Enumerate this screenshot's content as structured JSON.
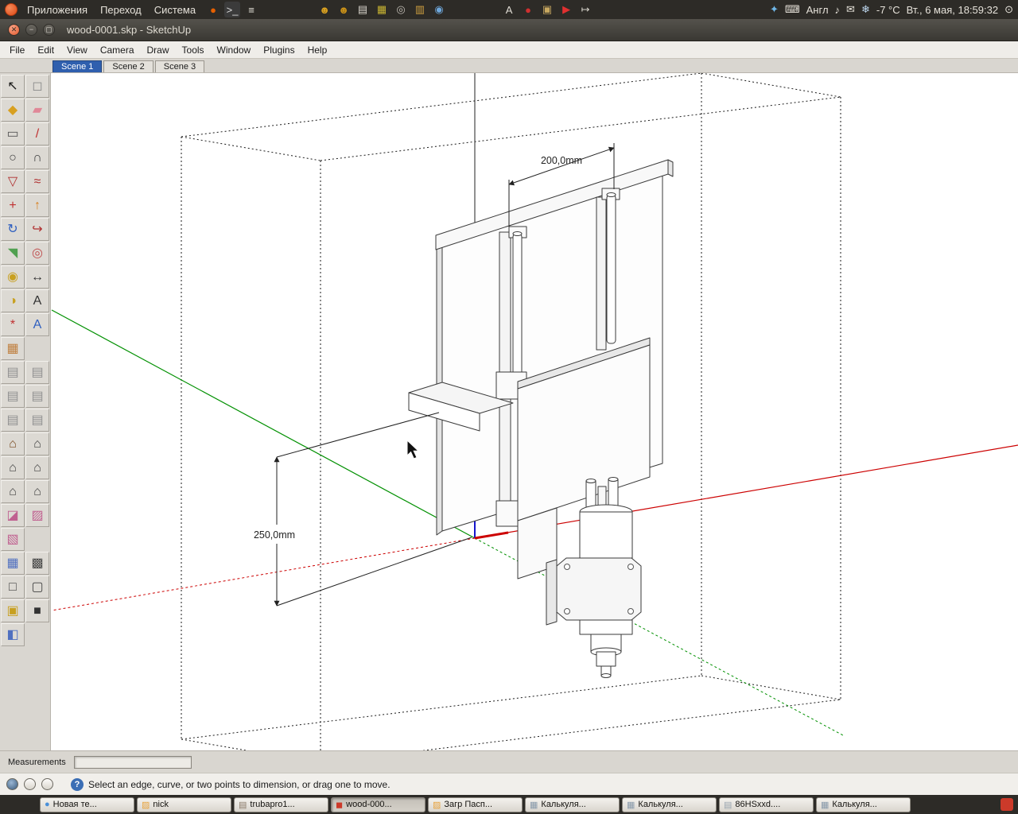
{
  "desktop": {
    "top_panel": {
      "menus": [
        "Приложения",
        "Переход",
        "Система"
      ],
      "launchers": [
        {
          "name": "firefox-icon",
          "glyph": "●",
          "color": "#E66000"
        },
        {
          "name": "terminal-icon",
          "glyph": ">_",
          "color": "#DDDDDD",
          "bg": "#3B3B3B"
        },
        {
          "name": "text-editor-icon",
          "glyph": "≡",
          "color": "#E8E4DC"
        },
        {
          "name": "spacer",
          "width": 64
        },
        {
          "name": "users-icon",
          "glyph": "☻",
          "color": "#D8A020"
        },
        {
          "name": "contacts-icon",
          "glyph": "☻",
          "color": "#C89018"
        },
        {
          "name": "notes-icon",
          "glyph": "▤",
          "color": "#D8D4CC"
        },
        {
          "name": "packages-icon",
          "glyph": "▦",
          "color": "#C8B432"
        },
        {
          "name": "disc-burner-icon",
          "glyph": "◎",
          "color": "#C0BCB4"
        },
        {
          "name": "archive-icon",
          "glyph": "▥",
          "color": "#D0A040"
        },
        {
          "name": "chromium-icon",
          "glyph": "◉",
          "color": "#6FA8DC"
        },
        {
          "name": "spacer",
          "width": 60
        },
        {
          "name": "fonts-icon",
          "glyph": "A",
          "color": "#E0DCD4"
        },
        {
          "name": "media-icon",
          "glyph": "●",
          "color": "#D03030"
        },
        {
          "name": "stamp-icon",
          "glyph": "▣",
          "color": "#C8A860"
        },
        {
          "name": "player-icon",
          "glyph": "▶",
          "color": "#E03030"
        },
        {
          "name": "share-icon",
          "glyph": "↦",
          "color": "#D8D4CC"
        }
      ],
      "keyboard_layout": "Англ",
      "weather": "-7 °C",
      "clock": "Вт., 6 мая, 18:59:32"
    },
    "icons": {
      "network": "✦",
      "keyboard": "⌨",
      "volume": "♪",
      "mail": "✉",
      "snowflake": "❄",
      "power": "⊙",
      "help": "?",
      "window_close": "✕",
      "window_min": "−",
      "window_max": "▢"
    }
  },
  "window": {
    "titlebar": {
      "title": "wood-0001.skp - SketchUp"
    },
    "menu_bar": [
      "File",
      "Edit",
      "View",
      "Camera",
      "Draw",
      "Tools",
      "Window",
      "Plugins",
      "Help"
    ],
    "scene_tabs": [
      {
        "label": "Scene 1",
        "active": true
      },
      {
        "label": "Scene 2",
        "active": false
      },
      {
        "label": "Scene 3",
        "active": false
      }
    ],
    "toolbar": [
      {
        "name": "select-tool",
        "glyph": "↖",
        "color": "#1A1A1A"
      },
      {
        "name": "make-component-tool",
        "glyph": "◻",
        "color": "#8A8A8A"
      },
      {
        "name": "paint-bucket-tool",
        "glyph": "◆",
        "color": "#D8A020"
      },
      {
        "name": "eraser-tool",
        "glyph": "▰",
        "color": "#E08898"
      },
      {
        "name": "rectangle-tool",
        "glyph": "▭",
        "color": "#555555"
      },
      {
        "name": "line-tool",
        "glyph": "/",
        "color": "#C03030"
      },
      {
        "name": "circle-tool",
        "glyph": "○",
        "color": "#444444"
      },
      {
        "name": "arc-tool",
        "glyph": "∩",
        "color": "#444444"
      },
      {
        "name": "polygon-tool",
        "glyph": "▽",
        "color": "#B03030"
      },
      {
        "name": "freehand-tool",
        "glyph": "≈",
        "color": "#B03030"
      },
      {
        "name": "move-tool",
        "glyph": "+",
        "color": "#C03030"
      },
      {
        "name": "push-pull-tool",
        "glyph": "↑",
        "color": "#D88020"
      },
      {
        "name": "rotate-tool",
        "glyph": "↻",
        "color": "#3060C0"
      },
      {
        "name": "follow-me-tool",
        "glyph": "↪",
        "color": "#B03030"
      },
      {
        "name": "scale-tool",
        "glyph": "◥",
        "color": "#50A050"
      },
      {
        "name": "offset-tool",
        "glyph": "◎",
        "color": "#C05050"
      },
      {
        "name": "tape-measure-tool",
        "glyph": "◉",
        "color": "#C8A020"
      },
      {
        "name": "dimension-tool",
        "glyph": "↔",
        "color": "#333333"
      },
      {
        "name": "protractor-tool",
        "glyph": "◑",
        "color": "#C8A020"
      },
      {
        "name": "text-tool",
        "glyph": "A",
        "color": "#333333"
      },
      {
        "name": "axes-tool",
        "glyph": "*",
        "color": "#C03030"
      },
      {
        "name": "3d-text-tool",
        "glyph": "A",
        "color": "#3060C0"
      },
      {
        "name": "plugin-box-tool",
        "glyph": "▦",
        "color": "#C08040"
      },
      null,
      {
        "name": "plugin-copy-tool-1",
        "glyph": "▤",
        "color": "#909090"
      },
      {
        "name": "plugin-copy-tool-2",
        "glyph": "▤",
        "color": "#909090"
      },
      {
        "name": "plugin-copy-tool-3",
        "glyph": "▤",
        "color": "#909090"
      },
      {
        "name": "plugin-copy-tool-4",
        "glyph": "▤",
        "color": "#909090"
      },
      {
        "name": "plugin-copy-tool-5",
        "glyph": "▤",
        "color": "#909090"
      },
      {
        "name": "plugin-copy-tool-6",
        "glyph": "▤",
        "color": "#909090"
      },
      {
        "name": "view-iso-button",
        "glyph": "⌂",
        "color": "#7A4A20"
      },
      {
        "name": "view-top-button",
        "glyph": "⌂",
        "color": "#444444"
      },
      {
        "name": "view-front-button",
        "glyph": "⌂",
        "color": "#444444"
      },
      {
        "name": "view-right-button",
        "glyph": "⌂",
        "color": "#444444"
      },
      {
        "name": "view-back-button",
        "glyph": "⌂",
        "color": "#444444"
      },
      {
        "name": "view-left-button",
        "glyph": "⌂",
        "color": "#444444"
      },
      {
        "name": "section-plane-tool",
        "glyph": "◪",
        "color": "#C06090"
      },
      {
        "name": "section-display-toggle",
        "glyph": "▨",
        "color": "#C06090"
      },
      {
        "name": "section-cut-toggle",
        "glyph": "▧",
        "color": "#C06090"
      },
      null,
      {
        "name": "style-xray-button",
        "glyph": "▦",
        "color": "#5070C0"
      },
      {
        "name": "style-back-edges-button",
        "glyph": "▩",
        "color": "#444444"
      },
      {
        "name": "style-wireframe-button",
        "glyph": "□",
        "color": "#444444"
      },
      {
        "name": "style-hidden-line-button",
        "glyph": "▢",
        "color": "#444444"
      },
      {
        "name": "style-shaded-button",
        "glyph": "▣",
        "color": "#C8A020"
      },
      {
        "name": "style-shaded-textures-button",
        "glyph": "■",
        "color": "#333333"
      },
      {
        "name": "style-monochrome-button",
        "glyph": "◧",
        "color": "#5070C0"
      },
      null
    ],
    "measurements": {
      "label": "Measurements",
      "value": ""
    },
    "status": {
      "text": "Select an edge, curve, or two points to dimension, or drag one to move.",
      "left_icons": [
        "status-globe-icon",
        "status-credits-icon",
        "status-signin-icon"
      ]
    }
  },
  "viewport": {
    "dim_width": "200,0mm",
    "dim_height": "250,0mm"
  },
  "taskbar": {
    "items": [
      {
        "label": "Новая те...",
        "icon_glyph": "●",
        "icon_color": "#4A90D9",
        "active": false
      },
      {
        "label": "nick",
        "icon_glyph": "▨",
        "icon_color": "#E8A33D",
        "active": false
      },
      {
        "label": "trubapro1...",
        "icon_glyph": "▤",
        "icon_color": "#8A7A6A",
        "active": false
      },
      {
        "label": "wood-000...",
        "icon_glyph": "◼",
        "icon_color": "#CC3A2A",
        "active": true
      },
      {
        "label": "Загр Пасп...",
        "icon_glyph": "▨",
        "icon_color": "#E8A33D",
        "active": false
      },
      {
        "label": "Калькуля...",
        "icon_glyph": "▦",
        "icon_color": "#8899AA",
        "active": false
      },
      {
        "label": "Калькуля...",
        "icon_glyph": "▦",
        "icon_color": "#8899AA",
        "active": false
      },
      {
        "label": "86HSxxd....",
        "icon_glyph": "▤",
        "icon_color": "#99A5B0",
        "active": false
      },
      {
        "label": "Калькуля...",
        "icon_glyph": "▦",
        "icon_color": "#8899AA",
        "active": false
      }
    ],
    "tray_icon_color": "#CC3A2A"
  },
  "colors": {
    "axis_red": "#CC0000",
    "axis_green": "#009000",
    "axis_blue": "#1515CC",
    "active_tab": "#2F5FAE",
    "panel_dark": "#2D2B27",
    "close_button": "#E25A2E",
    "help_badge": "#3B6EB5"
  }
}
